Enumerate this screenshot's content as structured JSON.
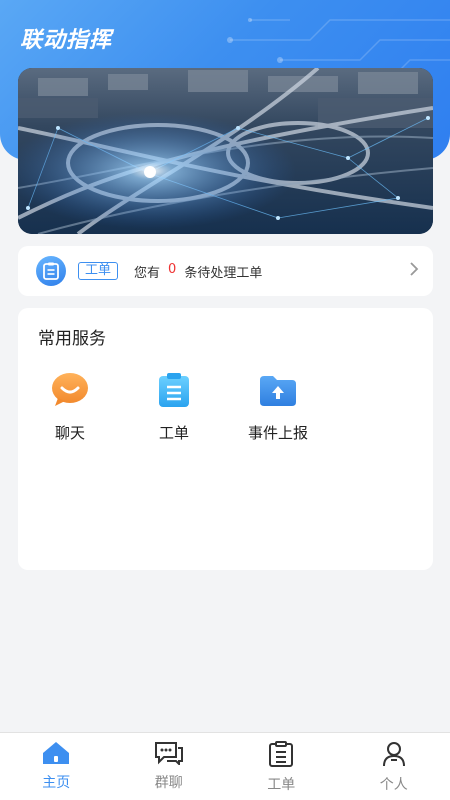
{
  "header": {
    "title": "联动指挥"
  },
  "notice": {
    "tag": "工单",
    "prefix": "您有",
    "count": "0",
    "suffix": "条待处理工单"
  },
  "services": {
    "title": "常用服务",
    "items": [
      {
        "label": "聊天",
        "icon": "chat-bubble-icon"
      },
      {
        "label": "工单",
        "icon": "clipboard-icon"
      },
      {
        "label": "事件上报",
        "icon": "upload-folder-icon"
      }
    ]
  },
  "tabbar": {
    "items": [
      {
        "label": "主页",
        "icon": "home-icon",
        "active": true
      },
      {
        "label": "群聊",
        "icon": "group-chat-icon",
        "active": false
      },
      {
        "label": "工单",
        "icon": "clipboard-icon",
        "active": false
      },
      {
        "label": "个人",
        "icon": "person-icon",
        "active": false
      }
    ]
  },
  "colors": {
    "primary": "#3d8ff0",
    "count_red": "#e33333",
    "background": "#f3f4f6"
  }
}
